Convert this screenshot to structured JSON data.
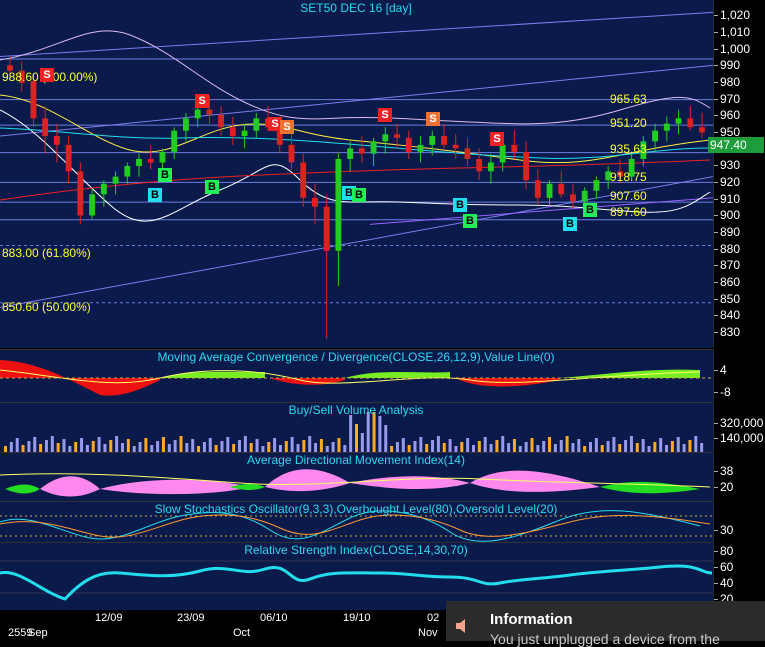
{
  "main": {
    "title": "SET50 DEC 16   [day]",
    "last_price": "947.40",
    "y_ticks": [
      "1,020",
      "1,010",
      "1,000",
      "990",
      "980",
      "970",
      "960",
      "950",
      "940",
      "930",
      "920",
      "910",
      "900",
      "890",
      "880",
      "870",
      "860",
      "850",
      "840",
      "830"
    ],
    "fib_labels": [
      "988.60 (100.00%)",
      "883.00 (61.80%)",
      "850.60 (50.00%)"
    ],
    "level_labels": [
      "965.63",
      "951.20",
      "935.63",
      "918.75",
      "907.60",
      "897.60"
    ],
    "sell_signal": "S",
    "buy_signal": "B"
  },
  "macd": {
    "title": "Moving Average Convergence / Divergence(CLOSE,26,12,9),Value Line(0)",
    "ticks": [
      "4",
      "-8"
    ]
  },
  "volume": {
    "title": "Buy/Sell Volume Analysis",
    "ticks": [
      "320,000",
      "140,000"
    ]
  },
  "adx": {
    "title": "Average Directional Movement Index(14)",
    "ticks": [
      "38",
      "20"
    ]
  },
  "stoch": {
    "title": "Slow Stochastics Oscillator(9,3,3),Overbought Level(80),Oversold Level(20)",
    "ticks": [
      "30"
    ]
  },
  "rsi": {
    "title": "Relative Strength Index(CLOSE,14,30,70)",
    "ticks": [
      "80",
      "60",
      "40",
      "20"
    ]
  },
  "x_axis": {
    "dates": [
      "12/09",
      "23/09",
      "06/10",
      "19/10",
      "02"
    ],
    "months": [
      "2559",
      "Sep",
      "Oct",
      "Nov"
    ]
  },
  "notification": {
    "title": "Information",
    "message": "You just unplugged a device from the",
    "icon": "speaker-icon"
  },
  "colors": {
    "background": "#0a1a4a",
    "up": "#22cc22",
    "down": "#dd2222",
    "sell": "#ee2222",
    "buy": "#22ee55",
    "buy_alt": "#22ddee"
  },
  "chart_data": {
    "type": "candlestick",
    "ylim": [
      825,
      1022
    ],
    "candles": [
      [
        985,
        990,
        978,
        982
      ],
      [
        982,
        987,
        970,
        975
      ],
      [
        976,
        980,
        950,
        955
      ],
      [
        955,
        962,
        935,
        945
      ],
      [
        945,
        952,
        930,
        940
      ],
      [
        940,
        945,
        918,
        925
      ],
      [
        925,
        930,
        895,
        900
      ],
      [
        900,
        915,
        898,
        912
      ],
      [
        912,
        920,
        905,
        918
      ],
      [
        918,
        925,
        912,
        922
      ],
      [
        922,
        930,
        918,
        928
      ],
      [
        928,
        935,
        922,
        932
      ],
      [
        932,
        940,
        926,
        930
      ],
      [
        930,
        938,
        925,
        936
      ],
      [
        936,
        950,
        932,
        948
      ],
      [
        948,
        958,
        942,
        955
      ],
      [
        955,
        965,
        950,
        960
      ],
      [
        960,
        968,
        952,
        957
      ],
      [
        957,
        962,
        945,
        950
      ],
      [
        950,
        956,
        940,
        945
      ],
      [
        945,
        952,
        938,
        948
      ],
      [
        948,
        958,
        944,
        955
      ],
      [
        955,
        962,
        948,
        950
      ],
      [
        950,
        955,
        935,
        940
      ],
      [
        940,
        946,
        926,
        930
      ],
      [
        930,
        935,
        905,
        910
      ],
      [
        910,
        918,
        895,
        905
      ],
      [
        905,
        912,
        830,
        880
      ],
      [
        880,
        935,
        860,
        932
      ],
      [
        932,
        942,
        925,
        938
      ],
      [
        938,
        945,
        930,
        935
      ],
      [
        935,
        944,
        928,
        942
      ],
      [
        942,
        950,
        935,
        946
      ],
      [
        946,
        952,
        938,
        944
      ],
      [
        944,
        948,
        932,
        936
      ],
      [
        936,
        945,
        930,
        940
      ],
      [
        940,
        948,
        934,
        945
      ],
      [
        945,
        952,
        938,
        940
      ],
      [
        940,
        946,
        932,
        938
      ],
      [
        938,
        944,
        928,
        932
      ],
      [
        932,
        938,
        920,
        925
      ],
      [
        925,
        935,
        918,
        930
      ],
      [
        930,
        942,
        925,
        940
      ],
      [
        940,
        948,
        932,
        936
      ],
      [
        936,
        942,
        915,
        920
      ],
      [
        920,
        926,
        906,
        910
      ],
      [
        910,
        920,
        905,
        918
      ],
      [
        918,
        925,
        910,
        912
      ],
      [
        912,
        918,
        904,
        908
      ],
      [
        908,
        916,
        904,
        914
      ],
      [
        914,
        922,
        910,
        920
      ],
      [
        920,
        928,
        915,
        925
      ],
      [
        925,
        932,
        918,
        922
      ],
      [
        922,
        935,
        920,
        932
      ],
      [
        932,
        945,
        928,
        942
      ],
      [
        942,
        952,
        936,
        948
      ],
      [
        948,
        956,
        942,
        952
      ],
      [
        952,
        960,
        946,
        955
      ],
      [
        955,
        962,
        948,
        950
      ],
      [
        950,
        958,
        944,
        947
      ]
    ]
  }
}
